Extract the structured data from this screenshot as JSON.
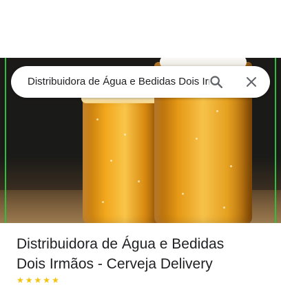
{
  "search": {
    "query": "Distribuidora de Água e Bedidas Dois Irmãos - Cerveja Delivery"
  },
  "place": {
    "name_line1": "Distribuidora de Água e Bedidas",
    "name_line2": "Dois Irmãos - Cerveja Delivery"
  },
  "icons": {
    "search": "search-icon",
    "close": "close-icon"
  },
  "colors": {
    "accent_green": "#2fbf3f",
    "star": "#f4c20d"
  }
}
